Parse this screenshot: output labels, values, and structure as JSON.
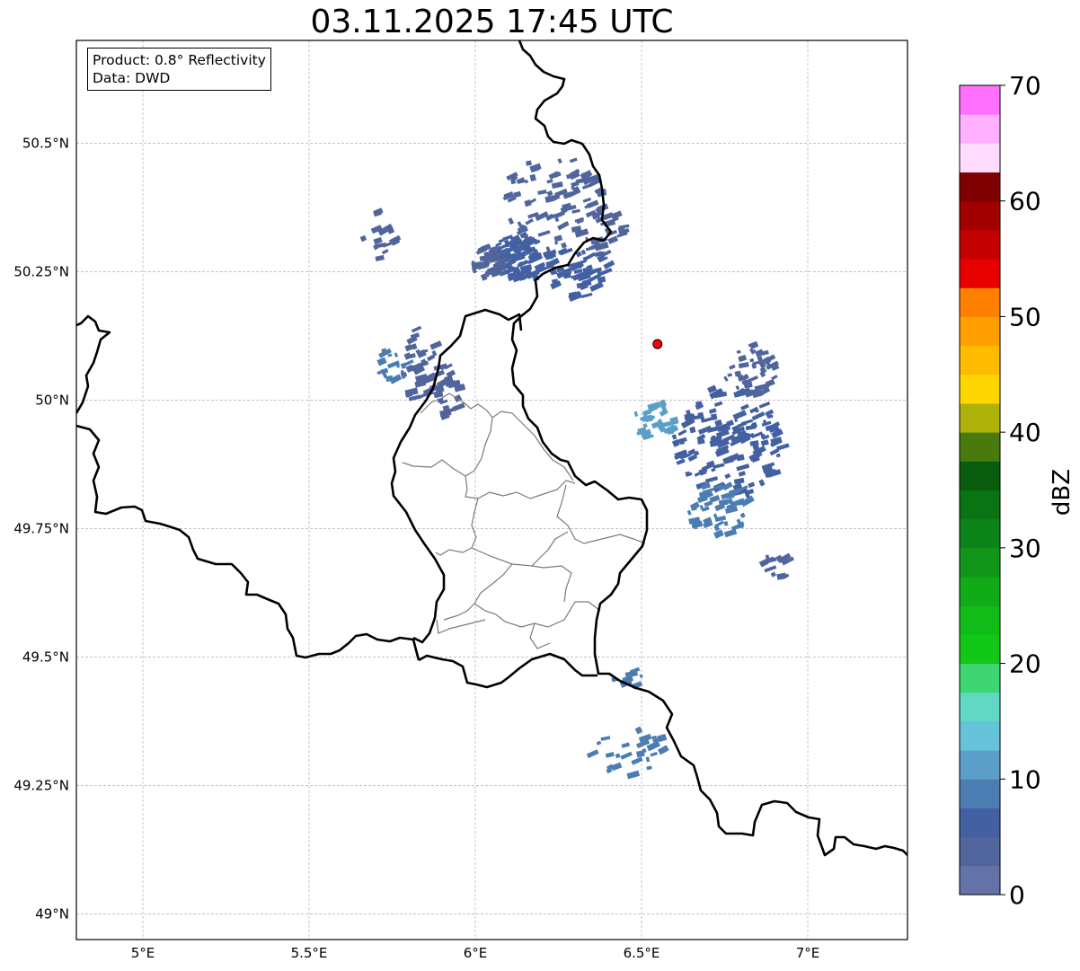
{
  "title": "03.11.2025 17:45 UTC",
  "info": {
    "product": "Product: 0.8° Reflectivity",
    "data": "Data: DWD"
  },
  "map": {
    "lon_range": [
      4.8,
      7.3
    ],
    "lat_range": [
      48.95,
      50.7
    ],
    "lon_ticks": [
      {
        "value": 5.0,
        "label": "5°E"
      },
      {
        "value": 5.5,
        "label": "5.5°E"
      },
      {
        "value": 6.0,
        "label": "6°E"
      },
      {
        "value": 6.5,
        "label": "6.5°E"
      },
      {
        "value": 7.0,
        "label": "7°E"
      }
    ],
    "lat_ticks": [
      {
        "value": 49.0,
        "label": "49°N"
      },
      {
        "value": 49.25,
        "label": "49.25°N"
      },
      {
        "value": 49.5,
        "label": "49.5°N"
      },
      {
        "value": 49.75,
        "label": "49.75°N"
      },
      {
        "value": 50.0,
        "label": "50°N"
      },
      {
        "value": 50.25,
        "label": "50.25°N"
      },
      {
        "value": 50.5,
        "label": "50.5°N"
      }
    ],
    "gridlines": true,
    "radar_site": {
      "lon": 6.548,
      "lat": 50.109,
      "color": "#ff0000"
    }
  },
  "colorbar": {
    "label": "dBZ",
    "min": 0,
    "max": 70,
    "step": 2.5,
    "tick_labels": [
      "0",
      "10",
      "20",
      "30",
      "40",
      "50",
      "60",
      "70"
    ],
    "colors": [
      "#6472a8",
      "#51659d",
      "#4360a2",
      "#4b7db3",
      "#5b9ec7",
      "#65c3da",
      "#60d8c3",
      "#3ed672",
      "#11c718",
      "#11bb18",
      "#11ab18",
      "#11961a",
      "#0c8318",
      "#0a7314",
      "#075d0d",
      "#497a0d",
      "#aeb20a",
      "#ffd700",
      "#ffbb00",
      "#ffa000",
      "#ff8000",
      "#e60000",
      "#c40000",
      "#a20000",
      "#7e0000",
      "#ffdcff",
      "#ffb0ff",
      "#ff70ff",
      "#ec30ec"
    ]
  },
  "echoes": [
    {
      "lon": 6.13,
      "lat": 50.28,
      "rx": 0.09,
      "ry": 0.045,
      "color": "#4360a2",
      "n": 90
    },
    {
      "lon": 6.03,
      "lat": 50.27,
      "rx": 0.05,
      "ry": 0.03,
      "color": "#51659d",
      "n": 40
    },
    {
      "lon": 6.22,
      "lat": 50.39,
      "rx": 0.15,
      "ry": 0.09,
      "color": "#51659d",
      "n": 80
    },
    {
      "lon": 6.3,
      "lat": 50.25,
      "rx": 0.09,
      "ry": 0.05,
      "color": "#4360a2",
      "n": 50
    },
    {
      "lon": 6.38,
      "lat": 50.32,
      "rx": 0.06,
      "ry": 0.05,
      "color": "#51659d",
      "n": 25
    },
    {
      "lon": 5.82,
      "lat": 50.07,
      "rx": 0.06,
      "ry": 0.07,
      "color": "#51659d",
      "n": 40
    },
    {
      "lon": 5.74,
      "lat": 50.06,
      "rx": 0.04,
      "ry": 0.05,
      "color": "#4b7db3",
      "n": 15
    },
    {
      "lon": 5.7,
      "lat": 50.32,
      "rx": 0.05,
      "ry": 0.05,
      "color": "#51659d",
      "n": 15
    },
    {
      "lon": 5.9,
      "lat": 50.01,
      "rx": 0.05,
      "ry": 0.06,
      "color": "#51659d",
      "n": 20
    },
    {
      "lon": 6.53,
      "lat": 49.96,
      "rx": 0.06,
      "ry": 0.04,
      "color": "#5b9ec7",
      "n": 35
    },
    {
      "lon": 6.75,
      "lat": 49.92,
      "rx": 0.16,
      "ry": 0.11,
      "color": "#4360a2",
      "n": 130
    },
    {
      "lon": 6.72,
      "lat": 49.79,
      "rx": 0.09,
      "ry": 0.05,
      "color": "#4b7db3",
      "n": 45
    },
    {
      "lon": 6.82,
      "lat": 50.06,
      "rx": 0.08,
      "ry": 0.05,
      "color": "#51659d",
      "n": 40
    },
    {
      "lon": 6.88,
      "lat": 49.68,
      "rx": 0.07,
      "ry": 0.03,
      "color": "#51659d",
      "n": 12
    },
    {
      "lon": 6.45,
      "lat": 49.46,
      "rx": 0.06,
      "ry": 0.015,
      "color": "#4b7db3",
      "n": 10
    },
    {
      "lon": 6.45,
      "lat": 49.32,
      "rx": 0.12,
      "ry": 0.05,
      "color": "#4b7db3",
      "n": 25
    }
  ]
}
